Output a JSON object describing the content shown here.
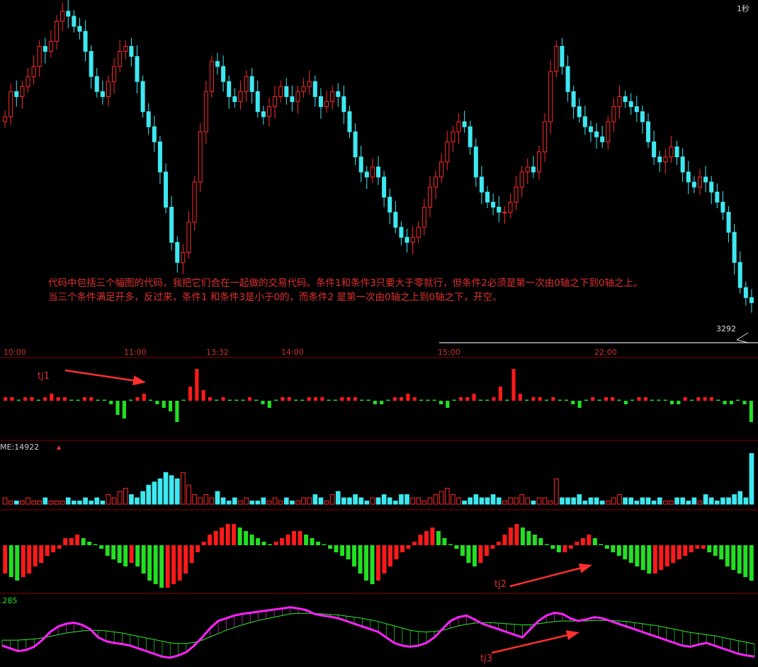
{
  "header": {
    "period": "1秒"
  },
  "annotation": {
    "line1": "代码中包括三个幅图的代码，我把它们合在一起做的交易代码。条件1和条件3只要大于零就行，但条件2必须是第一次由0轴之下到0轴之上。",
    "line2": "当三个条件满足开多，反过来，条件1 和条件3是小于0的，而条件2 是第一次由0轴之上到0轴之下，开空。"
  },
  "price_label": "3292",
  "panel_labels": {
    "volume": "ME:14922",
    "ma": ".285"
  },
  "markers": {
    "tj1": "tj1",
    "tj2": "tj2",
    "tj3": "tj3"
  },
  "colors": {
    "up": "#ff2a2a",
    "down": "#3ee8f0",
    "green": "#22e022",
    "red": "#ff1a1a",
    "magenta": "#ff22ff",
    "separator": "#8a0000"
  },
  "chart_data": [
    {
      "type": "candlestick",
      "x": [
        "10:00",
        "11:00",
        "13:32",
        "14:00",
        "15:00",
        "22:00"
      ],
      "close": [
        113,
        118,
        117,
        119,
        121,
        123,
        127,
        126,
        128,
        132,
        134,
        133,
        131,
        130,
        126,
        121,
        118,
        117,
        120,
        123,
        126,
        127,
        125,
        120,
        114,
        111,
        108,
        102,
        95,
        88,
        84,
        86,
        92,
        100,
        110,
        118,
        124,
        123,
        120,
        117,
        116,
        118,
        121,
        118,
        114,
        113,
        115,
        117,
        119,
        117,
        116,
        118,
        119,
        120,
        117,
        115,
        116,
        118,
        117,
        114,
        110,
        105,
        102,
        101,
        103,
        101,
        97,
        94,
        91,
        89,
        88,
        89,
        91,
        95,
        99,
        101,
        104,
        108,
        110,
        112,
        111,
        107,
        101,
        98,
        96,
        95,
        94,
        94,
        96,
        99,
        102,
        103,
        102,
        106,
        112,
        122,
        127,
        123,
        118,
        115,
        113,
        111,
        110,
        109,
        108,
        112,
        115,
        117,
        116,
        115,
        114,
        112,
        108,
        105,
        104,
        105,
        107,
        105,
        102,
        100,
        99,
        101,
        100,
        98,
        96,
        94,
        90,
        84,
        79,
        77,
        76
      ],
      "ylim": [
        70,
        132
      ]
    },
    {
      "type": "bar",
      "name": "tj1",
      "values": [
        1,
        1,
        0,
        1,
        1,
        0,
        1,
        2,
        1,
        1,
        0,
        0,
        1,
        1,
        0,
        0,
        -1,
        -4,
        -5,
        0,
        1,
        2,
        0,
        -1,
        -2,
        -3,
        -6,
        0,
        4,
        9,
        3,
        1,
        0,
        1,
        0,
        0,
        0,
        1,
        0,
        -1,
        -2,
        0,
        1,
        1,
        0,
        0,
        1,
        1,
        1,
        0,
        0,
        1,
        1,
        1,
        0,
        0,
        -1,
        -1,
        0,
        1,
        1,
        2,
        1,
        0,
        0,
        0,
        -1,
        -2,
        0,
        1,
        1,
        2,
        0,
        0,
        1,
        4,
        0,
        9,
        2,
        0,
        1,
        1,
        0,
        1,
        0,
        0,
        -1,
        -2,
        0,
        1,
        0,
        1,
        1,
        0,
        -1,
        0,
        1,
        1,
        0,
        0,
        0,
        -1,
        -1,
        1,
        0,
        1,
        1,
        1,
        0,
        -1,
        -1,
        0,
        -1,
        -6
      ],
      "ylim": [
        -10,
        10
      ]
    },
    {
      "type": "bar",
      "name": "ME",
      "values": [
        2,
        1,
        1,
        1,
        2,
        1,
        1,
        2,
        1,
        1,
        1,
        2,
        1,
        1,
        2,
        1,
        2,
        1,
        3,
        2,
        4,
        5,
        3,
        2,
        4,
        6,
        7,
        8,
        10,
        9,
        8,
        10,
        6,
        3,
        2,
        3,
        2,
        4,
        2,
        1,
        2,
        1,
        2,
        1,
        1,
        2,
        1,
        2,
        1,
        2,
        1,
        1,
        2,
        2,
        3,
        2,
        1,
        3,
        4,
        2,
        2,
        3,
        2,
        1,
        2,
        2,
        3,
        2,
        1,
        3,
        3,
        2,
        2,
        1,
        2,
        3,
        4,
        5,
        3,
        2,
        1,
        2,
        3,
        2,
        2,
        3,
        2,
        1,
        2,
        2,
        3,
        2,
        1,
        2,
        2,
        1,
        8,
        2,
        2,
        2,
        3,
        1,
        2,
        2,
        1,
        1,
        2,
        3,
        2,
        2,
        1,
        2,
        2,
        1,
        2,
        1,
        1,
        2,
        2,
        1,
        2,
        1,
        3,
        2,
        1,
        2,
        2,
        3,
        4,
        2,
        16
      ],
      "ylim": [
        0,
        17
      ]
    },
    {
      "type": "bar",
      "name": "tj2",
      "values": [
        -8,
        -9,
        -10,
        -9,
        -8,
        -6,
        -5,
        -3,
        -2,
        -1,
        2,
        2,
        3,
        2,
        1,
        0,
        -1,
        -3,
        -4,
        -5,
        -6,
        -5,
        -6,
        -8,
        -10,
        -11,
        -12,
        -12,
        -11,
        -10,
        -8,
        -5,
        -2,
        1,
        3,
        4,
        5,
        6,
        6,
        5,
        4,
        3,
        2,
        1,
        0,
        1,
        2,
        3,
        4,
        4,
        3,
        2,
        1,
        0,
        -1,
        -2,
        -3,
        -4,
        -6,
        -8,
        -10,
        -11,
        -10,
        -8,
        -6,
        -4,
        -2,
        -1,
        1,
        3,
        4,
        5,
        4,
        2,
        0,
        -1,
        -3,
        -5,
        -6,
        -5,
        -3,
        -1,
        1,
        3,
        5,
        6,
        5,
        4,
        3,
        2,
        0,
        -1,
        -2,
        -2,
        -1,
        1,
        2,
        3,
        2,
        0,
        -1,
        -2,
        -3,
        -4,
        -5,
        -6,
        -7,
        -8,
        -8,
        -7,
        -6,
        -5,
        -4,
        -3,
        -2,
        -1,
        -1,
        -2,
        -3,
        -4,
        -6,
        -7,
        -8,
        -9,
        -10
      ],
      "ylim": [
        -13,
        7
      ]
    },
    {
      "type": "line",
      "name": "tj3",
      "series": [
        {
          "values": [
            30,
            25,
            20,
            22,
            28,
            40,
            55,
            65,
            70,
            72,
            68,
            60,
            45,
            38,
            35,
            33,
            30,
            25,
            20,
            15,
            10,
            8,
            12,
            18,
            30,
            45,
            62,
            75,
            80,
            85,
            88,
            90,
            92,
            94,
            96,
            98,
            100,
            98,
            95,
            88,
            85,
            83,
            80,
            75,
            70,
            65,
            60,
            55,
            45,
            35,
            30,
            28,
            30,
            35,
            45,
            60,
            75,
            82,
            85,
            78,
            70,
            65,
            60,
            55,
            50,
            45,
            60,
            75,
            85,
            90,
            88,
            80,
            75,
            78,
            82,
            80,
            75,
            70,
            65,
            60,
            55,
            50,
            45,
            40,
            35,
            30,
            28,
            32,
            35,
            30,
            25,
            20,
            15,
            12,
            10
          ]
        },
        {
          "values": [
            40,
            40,
            40,
            41,
            42,
            44,
            47,
            50,
            53,
            55,
            57,
            58,
            58,
            57,
            55,
            53,
            50,
            47,
            44,
            41,
            38,
            35,
            34,
            34,
            36,
            40,
            46,
            52,
            58,
            63,
            68,
            72,
            76,
            79,
            82,
            85,
            88,
            89,
            89,
            89,
            88,
            87,
            86,
            84,
            82,
            80,
            77,
            74,
            70,
            66,
            62,
            58,
            56,
            55,
            56,
            58,
            62,
            66,
            69,
            71,
            72,
            72,
            71,
            70,
            69,
            68,
            68,
            70,
            72,
            74,
            75,
            75,
            75,
            75,
            76,
            76,
            76,
            75,
            74,
            72,
            70,
            68,
            66,
            63,
            60,
            57,
            54,
            52,
            50,
            48,
            45,
            42,
            39,
            36,
            33
          ]
        }
      ],
      "ylim": [
        0,
        110
      ]
    }
  ]
}
